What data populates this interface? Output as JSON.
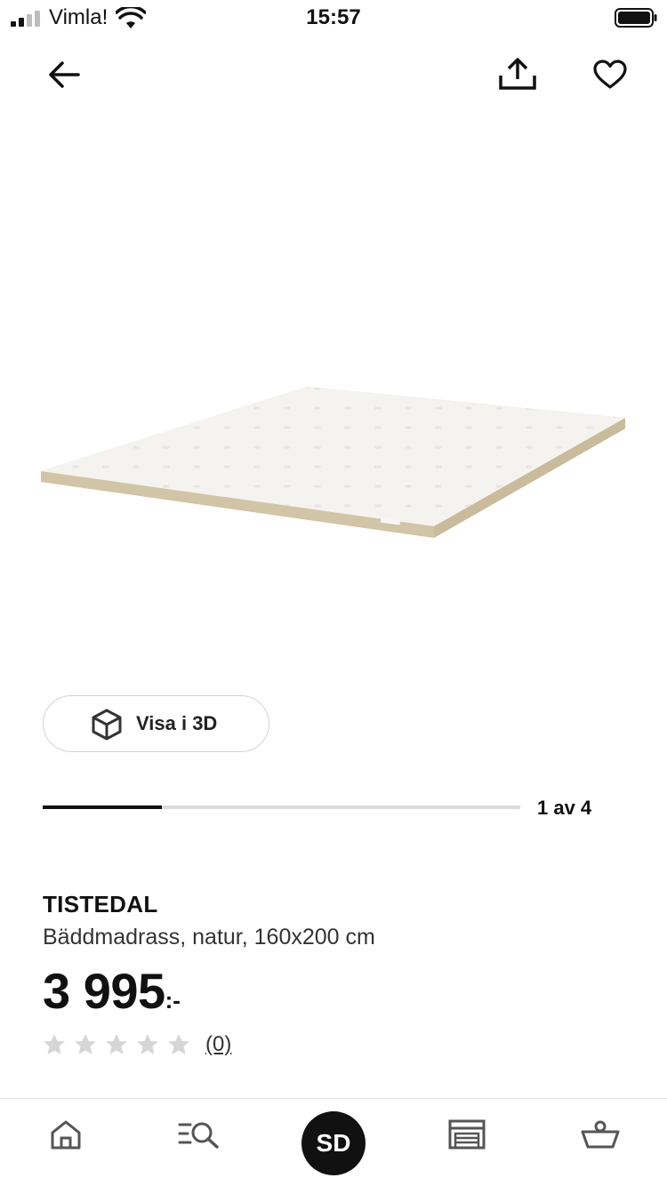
{
  "status_bar": {
    "carrier": "Vimla!",
    "time": "15:57"
  },
  "nav": {
    "back_icon": "arrow-left-icon",
    "share_icon": "share-icon",
    "favorite_icon": "heart-icon"
  },
  "gallery": {
    "image_description_icon": "mattress-topper-image",
    "view_3d_label": "Visa i 3D",
    "current_image": 1,
    "total_images": 4,
    "pager_text": "1 av 4"
  },
  "product": {
    "name": "TISTEDAL",
    "description": "Bäddmadrass, natur, 160x200 cm",
    "price": "3 995",
    "price_suffix": ":-",
    "rating": 0,
    "max_rating": 5,
    "review_count": "(0)"
  },
  "tab_bar": {
    "home_icon": "home-icon",
    "search_icon": "search-list-icon",
    "profile_initials": "SD",
    "stores_icon": "store-icon",
    "cart_icon": "shopping-basket-icon"
  },
  "colors": {
    "text": "#111111",
    "star_empty": "#d6d6d6",
    "progress_track": "#dcdcdc",
    "progress_fill": "#111111",
    "mattress_top": "#f4f3ef",
    "mattress_edge": "#d8ccb0"
  }
}
